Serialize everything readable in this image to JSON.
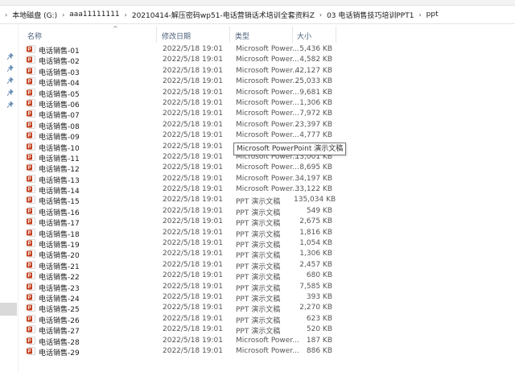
{
  "breadcrumb": [
    "本地磁盘 (G:)",
    "aaa11111111",
    "20210414-解压密码wp51-电话营销话术培训全套资料Z",
    "03 电话销售技巧培训PPT1",
    "ppt"
  ],
  "columns": {
    "name": "名称",
    "date": "修改日期",
    "type": "类型",
    "size": "大小"
  },
  "files": [
    {
      "name": "电话销售-01",
      "date": "2022/5/18 19:01",
      "type": "Microsoft Power...",
      "size": "5,436 KB"
    },
    {
      "name": "电话销售-02",
      "date": "2022/5/18 19:01",
      "type": "Microsoft Power...",
      "size": "4,582 KB"
    },
    {
      "name": "电话销售-03",
      "date": "2022/5/18 19:01",
      "type": "Microsoft Power...",
      "size": "42,127 KB"
    },
    {
      "name": "电话销售-04",
      "date": "2022/5/18 19:01",
      "type": "Microsoft Power...",
      "size": "25,033 KB"
    },
    {
      "name": "电话销售-05",
      "date": "2022/5/18 19:01",
      "type": "Microsoft Power...",
      "size": "9,681 KB"
    },
    {
      "name": "电话销售-06",
      "date": "2022/5/18 19:01",
      "type": "Microsoft Power...",
      "size": "1,306 KB"
    },
    {
      "name": "电话销售-07",
      "date": "2022/5/18 19:01",
      "type": "Microsoft Power...",
      "size": "7,972 KB"
    },
    {
      "name": "电话销售-08",
      "date": "2022/5/18 19:01",
      "type": "Microsoft Power...",
      "size": "23,397 KB"
    },
    {
      "name": "电话销售-09",
      "date": "2022/5/18 19:01",
      "type": "Microsoft Power...",
      "size": "4,777 KB"
    },
    {
      "name": "电话销售-10",
      "date": "2022/5/18 19:01",
      "type": "",
      "size": ""
    },
    {
      "name": "电话销售-11",
      "date": "2022/5/18 19:01",
      "type": "Microsoft Power...",
      "size": "13,001 KB"
    },
    {
      "name": "电话销售-12",
      "date": "2022/5/18 19:01",
      "type": "Microsoft Power...",
      "size": "8,695 KB"
    },
    {
      "name": "电话销售-13",
      "date": "2022/5/18 19:01",
      "type": "Microsoft Power...",
      "size": "34,197 KB"
    },
    {
      "name": "电话销售-14",
      "date": "2022/5/18 19:01",
      "type": "Microsoft Power...",
      "size": "33,122 KB"
    },
    {
      "name": "电话销售-15",
      "date": "2022/5/18 19:01",
      "type": "PPT 演示文稿",
      "size": "135,034 KB"
    },
    {
      "name": "电话销售-16",
      "date": "2022/5/18 19:01",
      "type": "PPT 演示文稿",
      "size": "549 KB"
    },
    {
      "name": "电话销售-17",
      "date": "2022/5/18 19:01",
      "type": "PPT 演示文稿",
      "size": "2,675 KB"
    },
    {
      "name": "电话销售-18",
      "date": "2022/5/18 19:01",
      "type": "PPT 演示文稿",
      "size": "1,816 KB"
    },
    {
      "name": "电话销售-19",
      "date": "2022/5/18 19:01",
      "type": "PPT 演示文稿",
      "size": "1,054 KB"
    },
    {
      "name": "电话销售-20",
      "date": "2022/5/18 19:01",
      "type": "PPT 演示文稿",
      "size": "1,306 KB"
    },
    {
      "name": "电话销售-21",
      "date": "2022/5/18 19:01",
      "type": "PPT 演示文稿",
      "size": "2,457 KB"
    },
    {
      "name": "电话销售-22",
      "date": "2022/5/18 19:01",
      "type": "PPT 演示文稿",
      "size": "680 KB"
    },
    {
      "name": "电话销售-23",
      "date": "2022/5/18 19:01",
      "type": "PPT 演示文稿",
      "size": "7,585 KB"
    },
    {
      "name": "电话销售-24",
      "date": "2022/5/18 19:01",
      "type": "PPT 演示文稿",
      "size": "393 KB"
    },
    {
      "name": "电话销售-25",
      "date": "2022/5/18 19:01",
      "type": "PPT 演示文稿",
      "size": "2,270 KB"
    },
    {
      "name": "电话销售-26",
      "date": "2022/5/18 19:01",
      "type": "PPT 演示文稿",
      "size": "623 KB"
    },
    {
      "name": "电话销售-27",
      "date": "2022/5/18 19:01",
      "type": "PPT 演示文稿",
      "size": "520 KB"
    },
    {
      "name": "电话销售-28",
      "date": "2022/5/18 19:01",
      "type": "Microsoft Power...",
      "size": "187 KB"
    },
    {
      "name": "电话销售-29",
      "date": "2022/5/18 19:01",
      "type": "Microsoft Power...",
      "size": "886 KB"
    }
  ],
  "tooltip": "Microsoft PowerPoint 演示文稿",
  "colors": {
    "ppt_icon": "#c43e1c",
    "header_text": "#4c607a",
    "selection": "#cce8ff"
  },
  "icons": {
    "file": "powerpoint-file-icon",
    "pin": "pin-icon"
  }
}
